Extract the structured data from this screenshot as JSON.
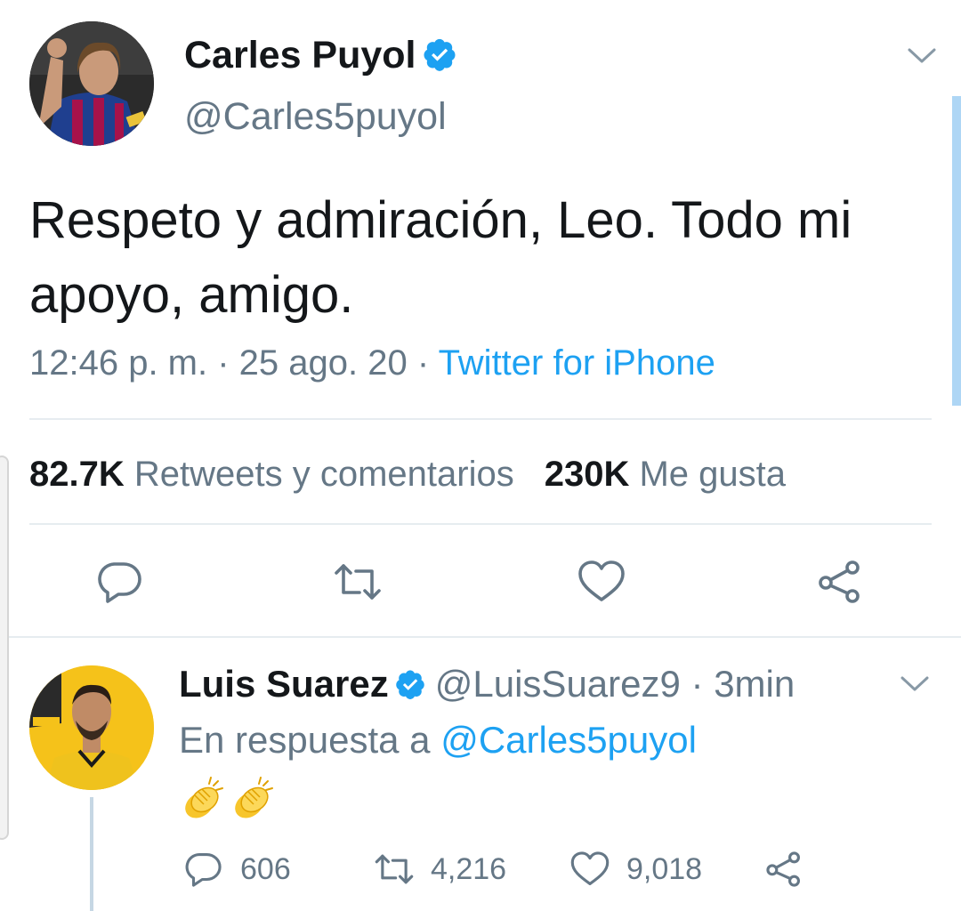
{
  "tweet": {
    "author_name": "Carles Puyol",
    "handle": "@Carles5puyol",
    "text": "Respeto y admiración, Leo. Todo mi apoyo, amigo.",
    "time": "12:46 p. m. · 25 ago. 20 · ",
    "source": "Twitter for iPhone",
    "stats": {
      "retweets_count": "82.7K",
      "retweets_label": "Retweets y comentarios",
      "likes_count": "230K",
      "likes_label": "Me gusta"
    },
    "icons": [
      "reply-icon",
      "retweet-icon",
      "like-icon",
      "share-icon"
    ]
  },
  "reply": {
    "author_name": "Luis Suarez",
    "handle_time": "@LuisSuarez9 · 3min",
    "reply_to_prefix": "En respuesta a ",
    "reply_to_handle": "@Carles5puyol",
    "emoji": [
      "clapping-hands",
      "clapping-hands"
    ],
    "actions": {
      "replies": "606",
      "retweets": "4,216",
      "likes": "9,018"
    }
  },
  "colors": {
    "accent": "#1da1f2",
    "secondary_text": "#657786",
    "primary_text": "#14171a",
    "divider": "#e6ecf0"
  }
}
